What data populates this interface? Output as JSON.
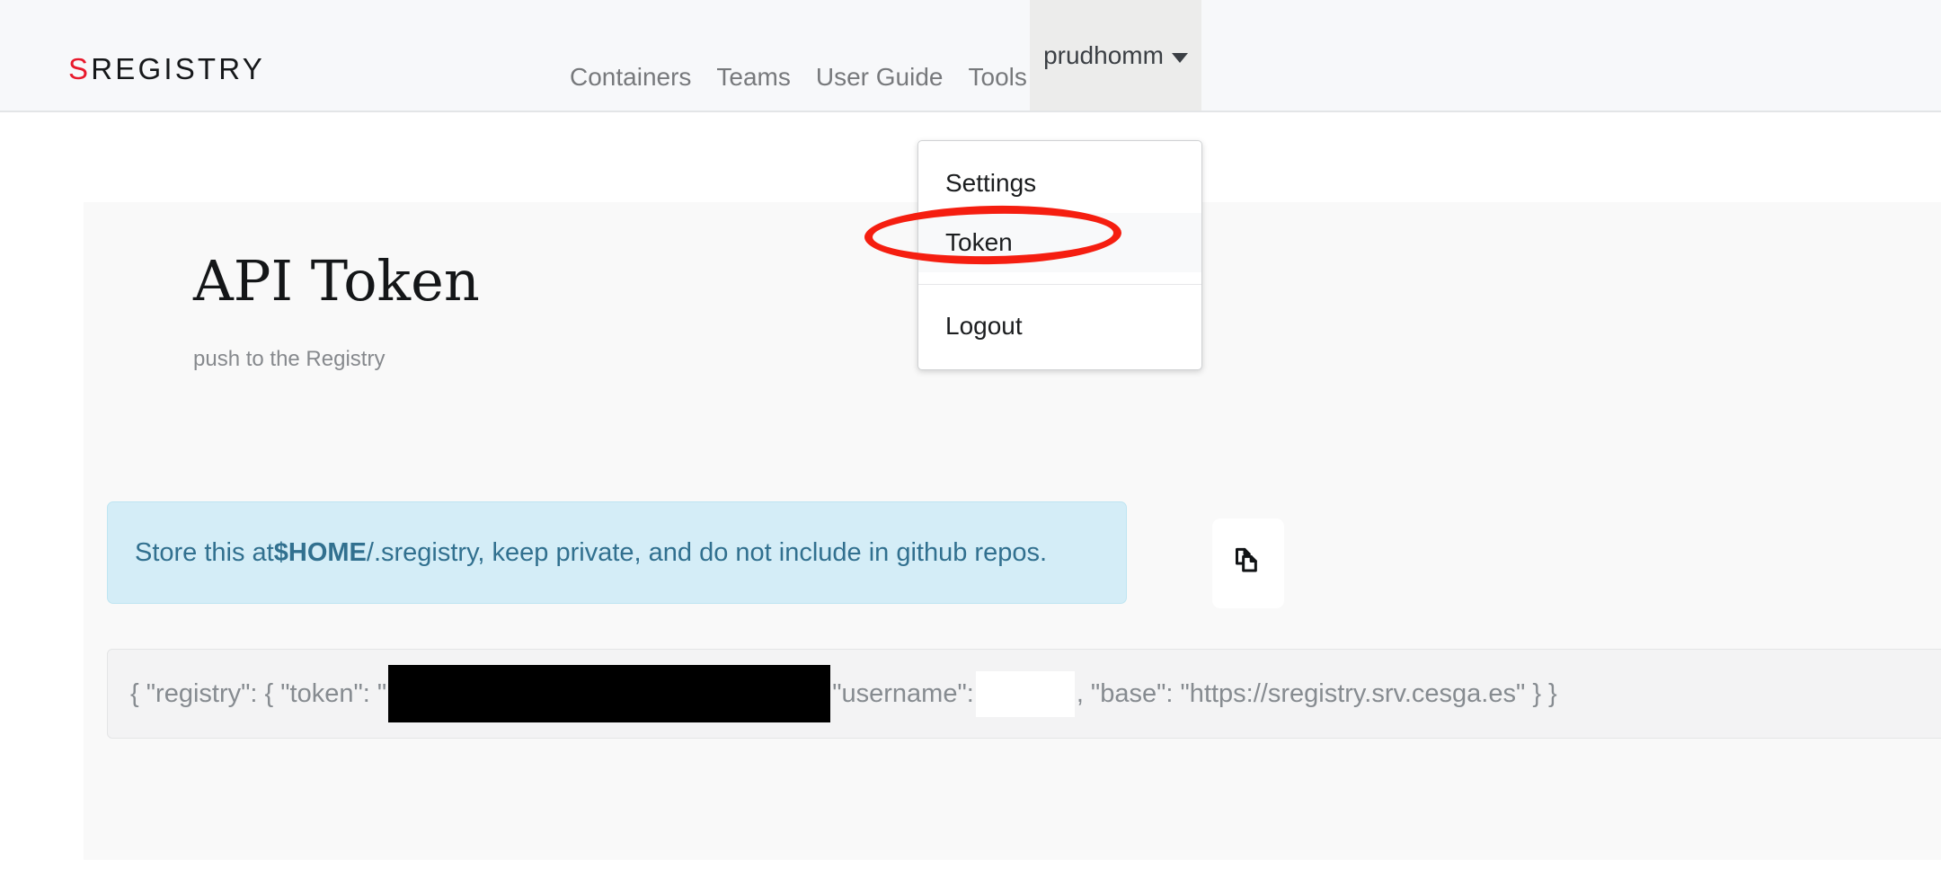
{
  "brand": {
    "first_letter": "S",
    "rest": "REGISTRY",
    "accent_color": "#e8192c"
  },
  "navbar": {
    "links": [
      {
        "label": "Containers",
        "name": "nav-link-containers"
      },
      {
        "label": "Teams",
        "name": "nav-link-teams"
      },
      {
        "label": "User Guide",
        "name": "nav-link-user-guide"
      },
      {
        "label": "Tools",
        "name": "nav-link-tools"
      }
    ],
    "user_menu": {
      "label": "prudhomm",
      "caret_icon": "chevron-down-icon",
      "open": true,
      "items": [
        {
          "label": "Settings",
          "name": "dropdown-item-settings",
          "active": false
        },
        {
          "label": "Token",
          "name": "dropdown-item-token",
          "active": true
        },
        {
          "label": "Logout",
          "name": "dropdown-item-logout",
          "active": false
        }
      ]
    }
  },
  "annotation": {
    "type": "ellipse-highlight",
    "target": "Token",
    "color": "#f51e10"
  },
  "main": {
    "title": "API Token",
    "subtitle": "push to the Registry",
    "alert": {
      "text_before": "Store this at ",
      "bold_text": "$HOME",
      "text_after": "/.sregistry, keep private, and do not include in github repos.",
      "bg_color": "#d4edf7",
      "text_color": "#31708f"
    },
    "copy_button": {
      "icon": "copy-icon",
      "label": ""
    },
    "code": {
      "prefix": "{ \"registry\": { \"token\": \"",
      "token_redacted": true,
      "middle": "\"username\":",
      "username_redacted": true,
      "suffix": ", \"base\": \"https://sregistry.srv.cesga.es\" } }"
    }
  }
}
